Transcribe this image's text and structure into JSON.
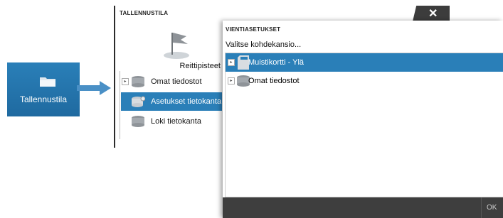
{
  "tile": {
    "label": "Tallennustila",
    "icon": "folder-icon"
  },
  "panel": {
    "title": "TALLENNUSTILA",
    "waypoints_label": "Reittipisteet",
    "items": [
      {
        "label": "Omat tiedostot",
        "icon": "database-icon",
        "selected": false
      },
      {
        "label": "Asetukset tietokanta",
        "icon": "database-gear-icon",
        "selected": true
      },
      {
        "label": "Loki tietokanta",
        "icon": "database-icon",
        "selected": false
      }
    ]
  },
  "dialog": {
    "title": "VIENTIASETUKSET",
    "prompt": "Valitse kohdekansio...",
    "rows": [
      {
        "label": "Muistikortti - Ylä",
        "icon": "sd-card-icon",
        "selected": true
      },
      {
        "label": "Omat tiedostot",
        "icon": "database-icon",
        "selected": false
      }
    ],
    "ok_label": "OK"
  },
  "colors": {
    "accent": "#2a7fb8",
    "footer": "#3e3e3e"
  }
}
